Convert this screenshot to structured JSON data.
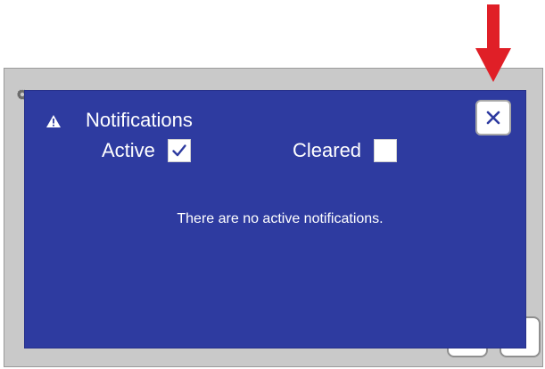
{
  "dialog": {
    "title": "Notifications",
    "filters": {
      "active": {
        "label": "Active",
        "checked": true
      },
      "cleared": {
        "label": "Cleared",
        "checked": false
      }
    },
    "message": "There are no active notifications.",
    "close_icon": "close-icon"
  },
  "icons": {
    "warning": "warning-icon",
    "gear": "gear-icon",
    "arrow": "down-arrow-icon"
  },
  "colors": {
    "dialog_background": "#2e3ba0",
    "arrow": "#e01f27"
  }
}
